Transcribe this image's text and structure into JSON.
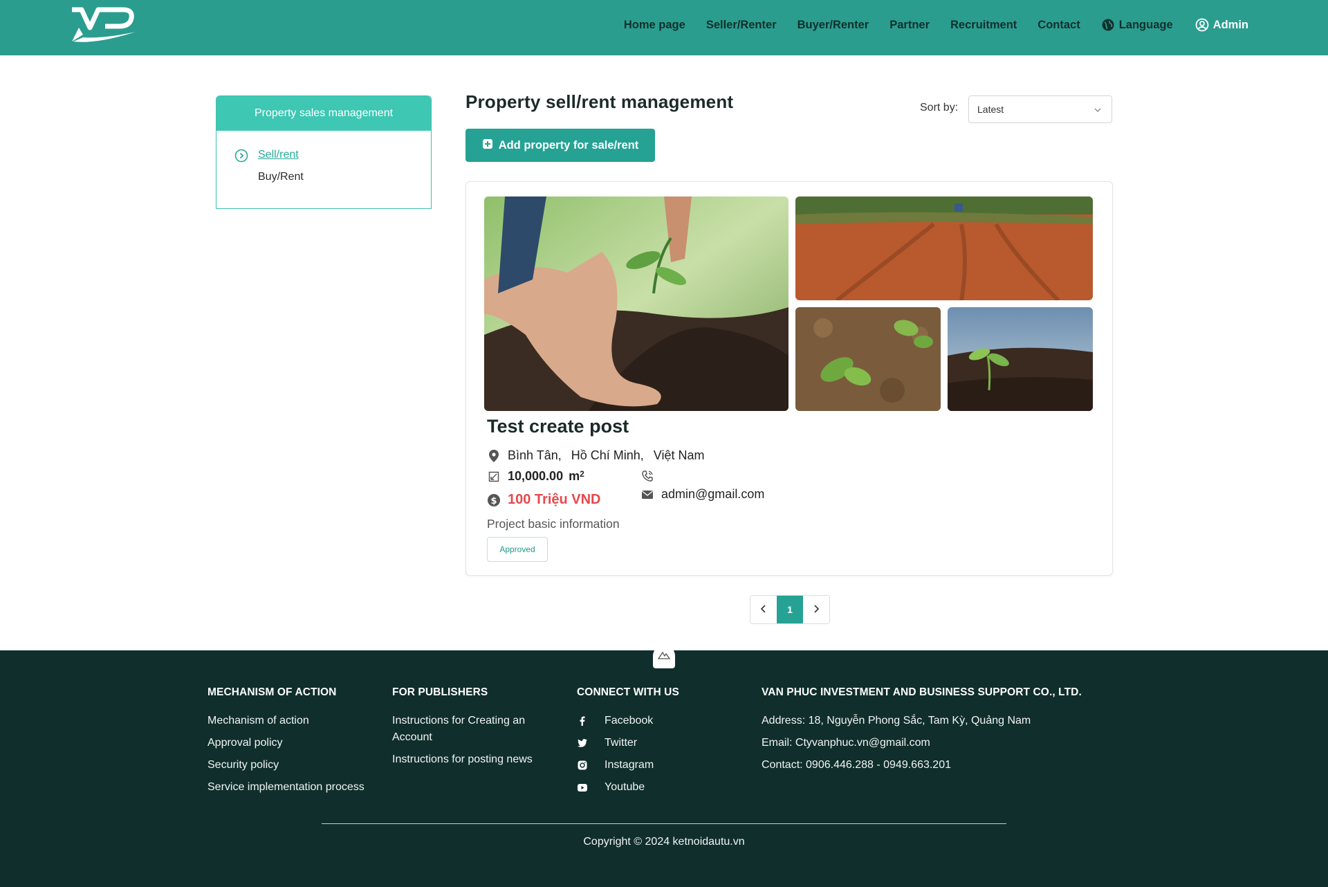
{
  "header": {
    "nav": [
      {
        "label": "Home page"
      },
      {
        "label": "Seller/Renter"
      },
      {
        "label": "Buyer/Renter"
      },
      {
        "label": "Partner"
      },
      {
        "label": "Recruitment"
      },
      {
        "label": "Contact"
      }
    ],
    "language_label": "Language",
    "admin_label": "Admin"
  },
  "sidebar": {
    "title": "Property sales management",
    "items": [
      {
        "label": "Sell/rent",
        "active": true
      },
      {
        "label": "Buy/Rent",
        "active": false
      }
    ]
  },
  "main": {
    "title": "Property sell/rent management",
    "sort_label": "Sort by:",
    "sort_value": "Latest",
    "add_button": "Add property for sale/rent"
  },
  "listing": {
    "title": "Test create post",
    "location": [
      "Bình Tân,",
      "Hồ Chí Minh,",
      "Việt Nam"
    ],
    "area_value": "10,000.00",
    "area_unit": "m",
    "area_unit_sup": "2",
    "price": "100 Triệu VND",
    "phone": "",
    "email": "admin@gmail.com",
    "description": "Project basic information",
    "status": "Approved"
  },
  "pagination": {
    "current": "1"
  },
  "footer": {
    "col1": {
      "title": "MECHANISM OF ACTION",
      "links": [
        "Mechanism of action",
        "Approval policy",
        "Security policy",
        "Service implementation process"
      ]
    },
    "col2": {
      "title": "FOR PUBLISHERS",
      "links": [
        "Instructions for Creating an Account",
        "Instructions for posting news"
      ]
    },
    "col3": {
      "title": "CONNECT WITH US",
      "links": [
        {
          "icon": "facebook-icon",
          "label": "Facebook"
        },
        {
          "icon": "twitter-icon",
          "label": "Twitter"
        },
        {
          "icon": "instagram-icon",
          "label": "Instagram"
        },
        {
          "icon": "youtube-icon",
          "label": "Youtube"
        }
      ]
    },
    "col4": {
      "title": "VAN PHUC INVESTMENT AND BUSINESS SUPPORT CO., LTD.",
      "lines": [
        "Address: 18, Nguyễn Phong Sắc, Tam Kỳ, Quảng Nam",
        "Email: Ctyvanphuc.vn@gmail.com",
        "Contact: 0906.446.288 - 0949.663.201"
      ]
    },
    "copyright": "Copyright © 2024 ketnoidautu.vn"
  },
  "colors": {
    "header_bg": "#2a9d8f",
    "accent": "#25a294",
    "price": "#e5484d",
    "footer_bg": "#0f2e2c"
  }
}
